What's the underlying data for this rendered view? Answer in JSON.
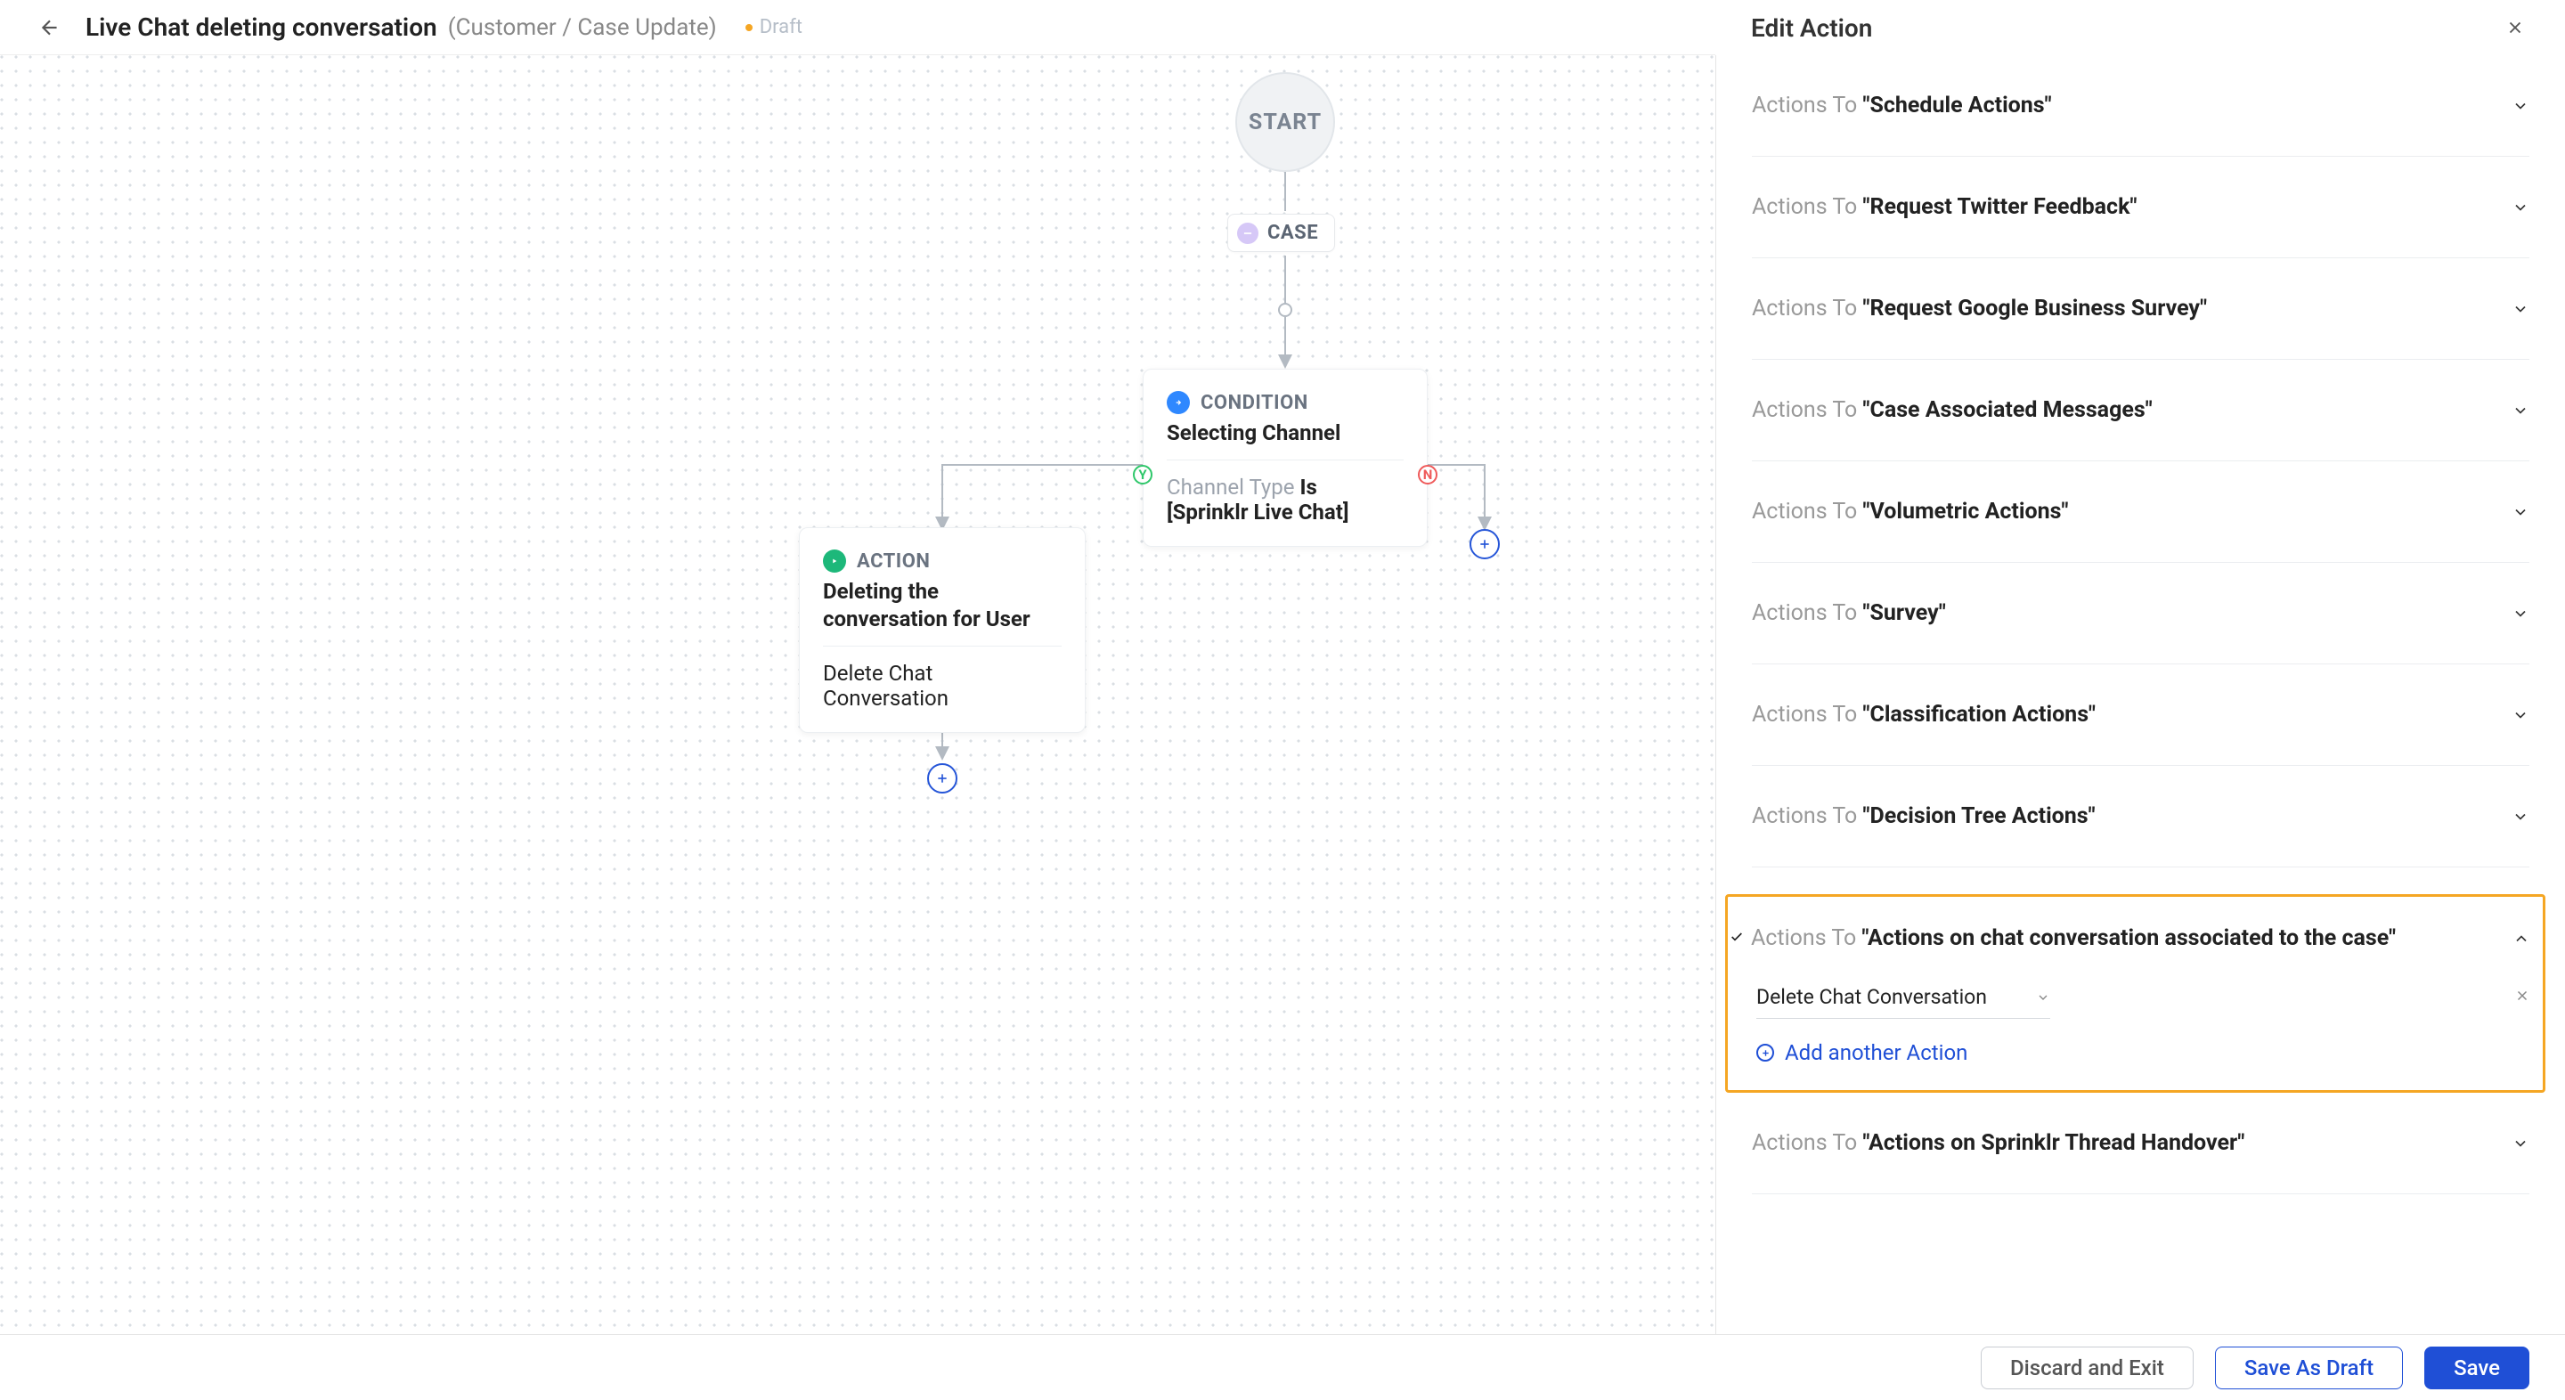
{
  "header": {
    "title": "Live Chat deleting conversation",
    "subtitle": "(Customer / Case Update)",
    "status": "Draft"
  },
  "canvas": {
    "start": "START",
    "case_label": "CASE",
    "condition": {
      "type_label": "CONDITION",
      "title": "Selecting Channel",
      "body_prefix": "Channel Type",
      "body_value": "Is [Sprinklr Live Chat]"
    },
    "action": {
      "type_label": "ACTION",
      "title": "Deleting the conversation for User",
      "body": "Delete Chat Conversation"
    }
  },
  "panel": {
    "title": "Edit Action",
    "actions_to": "Actions To",
    "rows": [
      {
        "label": "\"Schedule Actions\""
      },
      {
        "label": "\"Request Twitter Feedback\""
      },
      {
        "label": "\"Request Google Business Survey\""
      },
      {
        "label": "\"Case Associated Messages\""
      },
      {
        "label": "\"Volumetric Actions\""
      },
      {
        "label": "\"Survey\""
      },
      {
        "label": "\"Classification Actions\""
      },
      {
        "label": "\"Decision Tree Actions\""
      }
    ],
    "expanded": {
      "label": "\"Actions on chat conversation associated to the case\"",
      "selected_action": "Delete Chat Conversation",
      "add_label": "Add another Action"
    },
    "after": [
      {
        "label": "\"Actions on Sprinklr Thread Handover\""
      }
    ]
  },
  "footer": {
    "discard": "Discard and Exit",
    "save_draft": "Save As Draft",
    "save": "Save"
  }
}
